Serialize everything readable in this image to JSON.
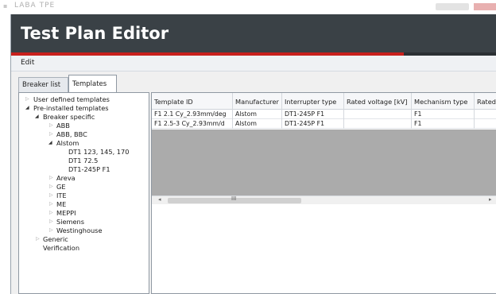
{
  "window": {
    "strip_title": "LABA TPE",
    "app_title": "Test Plan Editor"
  },
  "menu": {
    "edit": "Edit"
  },
  "tabs": [
    {
      "label": "Breaker list",
      "selected": false
    },
    {
      "label": "Templates",
      "selected": true
    }
  ],
  "tree": {
    "user_defined": "User defined templates",
    "pre_installed": "Pre-installed templates",
    "breaker_specific": "Breaker specific",
    "abb": "ABB",
    "abb_bbc": "ABB, BBC",
    "alstom": "Alstom",
    "dt1_123": "DT1 123, 145, 170",
    "dt1_725": "DT1 72.5",
    "dt1_245": "DT1-245P F1",
    "areva": "Areva",
    "ge": "GE",
    "ite": "ITE",
    "me": "ME",
    "meppi": "MEPPI",
    "siemens": "Siemens",
    "westinghouse": "Westinghouse",
    "generic": "Generic",
    "verification": "Verification",
    "collapsed_glyph": "▷",
    "expanded_glyph": "◢"
  },
  "grid": {
    "columns": [
      "Template ID",
      "Manufacturer",
      "Interrupter type",
      "Rated voltage [kV]",
      "Mechanism type",
      "Rated"
    ],
    "rows": [
      [
        "F1 2.1 Cy_2.93mm/deg",
        "Alstom",
        "DT1-245P F1",
        "",
        "F1",
        ""
      ],
      [
        "F1 2.5-3 Cy_2.93mm/d",
        "Alstom",
        "DT1-245P F1",
        "",
        "F1",
        ""
      ]
    ],
    "scroll_left": "◂",
    "scroll_grip": "III",
    "scroll_right": "▸"
  }
}
